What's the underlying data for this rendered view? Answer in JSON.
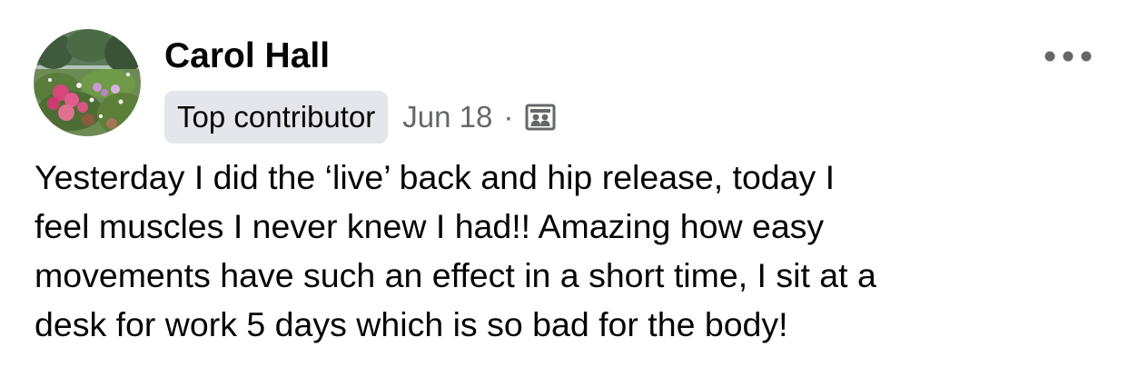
{
  "post": {
    "author": {
      "name": "Carol Hall",
      "avatar_icon": "profile-photo-garden"
    },
    "badge": "Top contributor",
    "date": "Jun 18",
    "separator": "·",
    "audience_icon": "group-members-icon",
    "more_icon": "more-options-icon",
    "text": "Yesterday I did the ‘live’ back and hip release, today I\nfeel muscles I never knew I had!! Amazing how easy\nmovements have such an effect in a short time, I sit at a\ndesk for work 5 days which is so bad for the body!"
  },
  "colors": {
    "text": "#050505",
    "secondary_text": "#65676b",
    "badge_background": "#e4e6eb",
    "background": "#ffffff"
  }
}
